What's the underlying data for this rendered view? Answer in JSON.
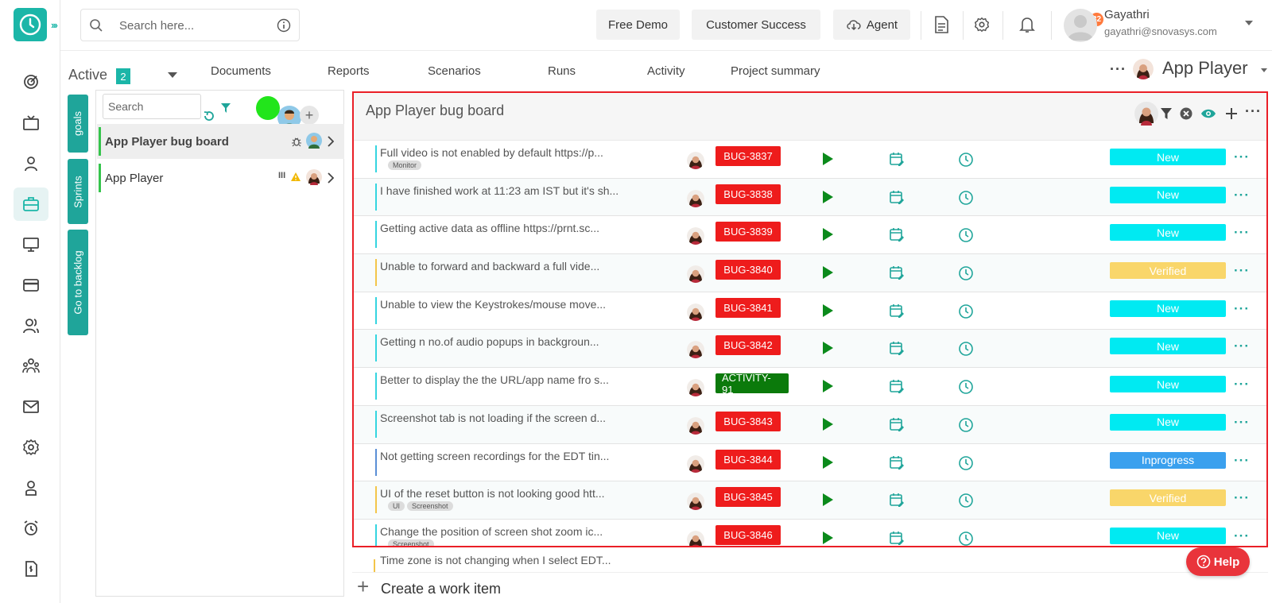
{
  "search": {
    "placeholder": "Search here..."
  },
  "header": {
    "free_demo": "Free Demo",
    "customer_success": "Customer Success",
    "agent": "Agent",
    "notification_count": "32",
    "user_name": "Gayathri",
    "user_email": "gayathri@snovasys.com"
  },
  "subnav": {
    "active_label": "Active",
    "active_count": "2",
    "tabs": [
      "Documents",
      "Reports",
      "Scenarios",
      "Runs",
      "Activity",
      "Project summary"
    ],
    "project_name": "App Player"
  },
  "side_tabs": {
    "goals": "goals",
    "sprints": "Sprints",
    "backlog": "Go to backlog"
  },
  "goals": {
    "search_placeholder": "Search",
    "items": [
      {
        "name": "App Player bug board"
      },
      {
        "name": "App Player"
      }
    ]
  },
  "board": {
    "title": "App Player bug board",
    "rows": [
      {
        "title": "Full video is not enabled by default https://p...",
        "tags": [
          "Monitor"
        ],
        "code": "BUG-3837",
        "code_type": "bug",
        "status": "New"
      },
      {
        "title": "I have finished work at 11:23 am IST but it's sh...",
        "tags": [],
        "code": "BUG-3838",
        "code_type": "bug",
        "status": "New"
      },
      {
        "title": "Getting active data as offline https://prnt.sc...",
        "tags": [],
        "code": "BUG-3839",
        "code_type": "bug",
        "status": "New"
      },
      {
        "title": "Unable to forward and backward a full vide...",
        "tags": [],
        "code": "BUG-3840",
        "code_type": "bug",
        "status": "Verified"
      },
      {
        "title": "Unable to view the Keystrokes/mouse move...",
        "tags": [],
        "code": "BUG-3841",
        "code_type": "bug",
        "status": "New"
      },
      {
        "title": "Getting n no.of audio popups in backgroun...",
        "tags": [],
        "code": "BUG-3842",
        "code_type": "bug",
        "status": "New"
      },
      {
        "title": "Better to display the the URL/app name fro s...",
        "tags": [],
        "code": "ACTIVITY-91",
        "code_type": "activity",
        "status": "New"
      },
      {
        "title": "Screenshot tab is not loading if the screen d...",
        "tags": [],
        "code": "BUG-3843",
        "code_type": "bug",
        "status": "New"
      },
      {
        "title": "Not getting screen recordings for the EDT tin...",
        "tags": [],
        "code": "BUG-3844",
        "code_type": "bug",
        "status": "Inprogress"
      },
      {
        "title": "UI of the reset button is not looking good htt...",
        "tags": [
          "UI",
          "Screenshot"
        ],
        "code": "BUG-3845",
        "code_type": "bug",
        "status": "Verified"
      },
      {
        "title": "Change the position of screen shot zoom ic...",
        "tags": [
          "Screenshot"
        ],
        "code": "BUG-3846",
        "code_type": "bug",
        "status": "New"
      }
    ],
    "peek_row": {
      "title": "Time zone is not changing when I select EDT..."
    }
  },
  "create_label": "Create a work item",
  "help_label": "Help",
  "colors": {
    "accent": "#1bb6a8",
    "bug": "#ee1c1c",
    "activity": "#0b7a0b",
    "status_New": "#00eaf2",
    "status_Verified": "#f9d66a",
    "status_Inprogress": "#3aa0ee",
    "highlight": "#ea1f27"
  }
}
